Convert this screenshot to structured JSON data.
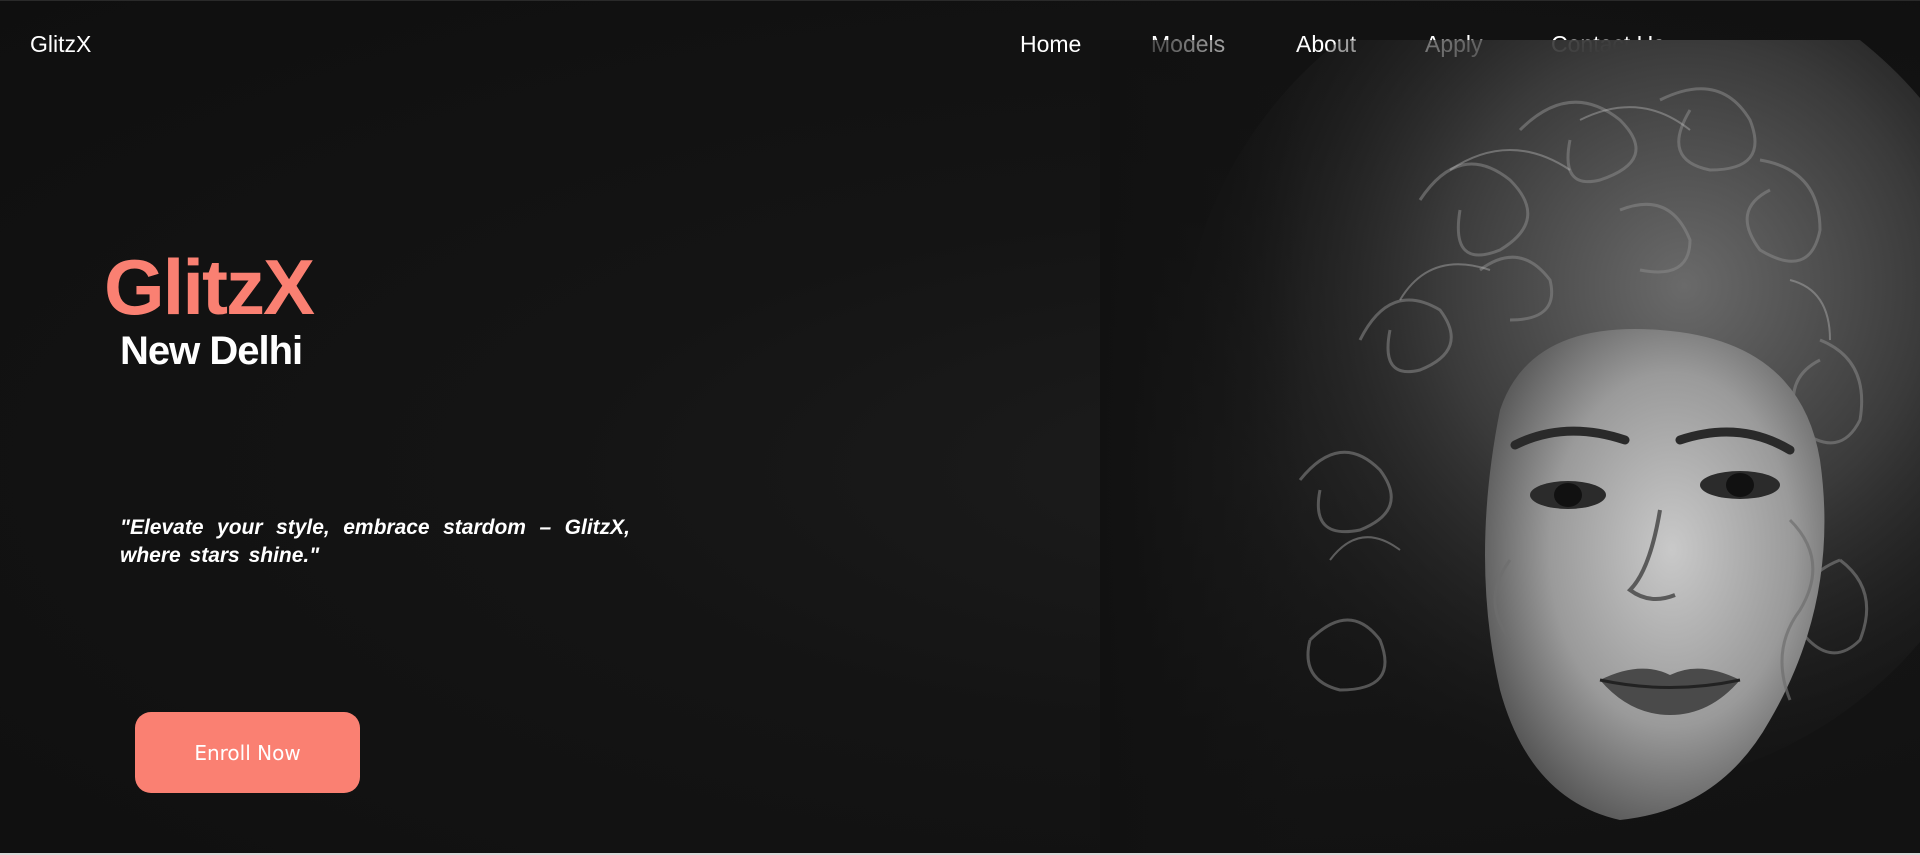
{
  "nav": {
    "brand": "GlitzX",
    "items": [
      {
        "label": "Home"
      },
      {
        "label": "Models"
      },
      {
        "label": "About"
      },
      {
        "label": "Apply"
      },
      {
        "label": "Contact Us"
      }
    ]
  },
  "hero": {
    "title": "GlitzX",
    "city": "New Delhi",
    "tagline": "\"Elevate your style, embrace stardom – GlitzX, where stars shine.\"",
    "cta_label": "Enroll Now"
  },
  "colors": {
    "accent": "#fa8072",
    "background": "#111111",
    "text": "#ffffff"
  },
  "image": {
    "subject": "black-and-white-portrait-photo"
  }
}
